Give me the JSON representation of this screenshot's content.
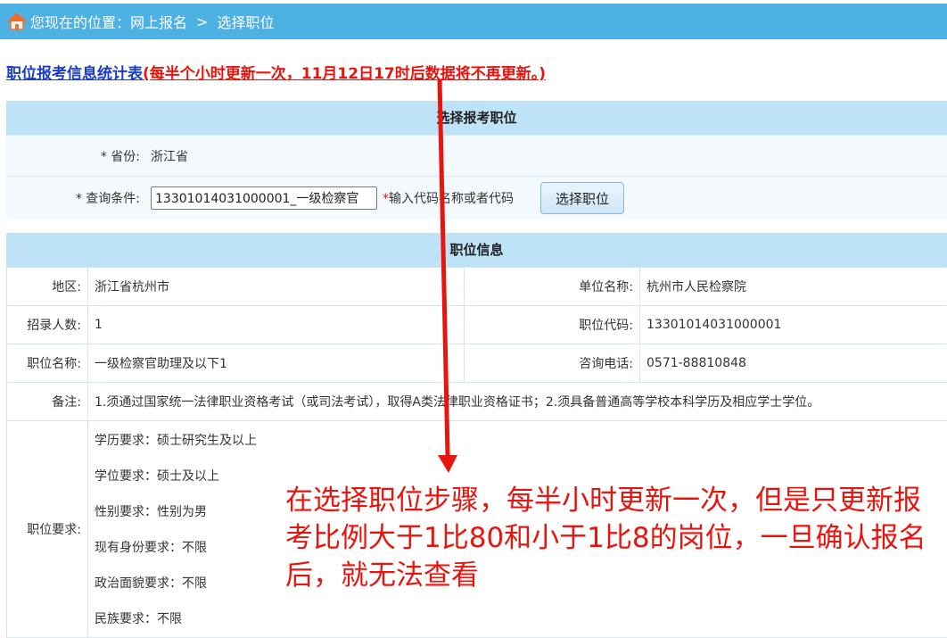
{
  "breadcrumb": {
    "prefix": "您现在的位置：",
    "items": [
      "网上报名",
      "选择职位"
    ],
    "separator": ">"
  },
  "headline": {
    "link": "职位报考信息统计表",
    "note": "(每半个小时更新一次，11月12日17时后数据将不再更新。)"
  },
  "select_panel": {
    "title": "选择报考职位",
    "province_label": "* 省份:",
    "province_value": "浙江省",
    "query_label": "* 查询条件:",
    "query_value": "13301014031000001_一级检察官",
    "hint_mark": "*",
    "hint": "输入代码名称或者代码",
    "button": "选择职位"
  },
  "info_panel": {
    "title": "职位信息",
    "rows": [
      {
        "k1": "地区:",
        "v1": "浙江省杭州市",
        "k2": "单位名称:",
        "v2": "杭州市人民检察院"
      },
      {
        "k1": "招录人数:",
        "v1": "1",
        "k2": "职位代码:",
        "v2": "13301014031000001"
      },
      {
        "k1": "职位名称:",
        "v1": "一级检察官助理及以下1",
        "k2": "咨询电话:",
        "v2": "0571-88810848"
      }
    ],
    "remark_label": "备注:",
    "remark": "1.须通过国家统一法律职业资格考试（或司法考试），取得A类法律职业资格证书；2.须具备普通高等学校本科学历及相应学士学位。",
    "requirements_label": "职位要求:",
    "requirements": [
      "学历要求：硕士研究生及以上",
      "学位要求：硕士及以上",
      "性别要求：性别为男",
      "现有身份要求：不限",
      "政治面貌要求：不限",
      "民族要求：不限"
    ]
  },
  "annotation": "在选择职位步骤，每半小时更新一次，但是只更新报考比例大于1比80和小于1比8的岗位，一旦确认报名后，就无法查看",
  "colors": {
    "topbar": "#4eb1e4",
    "panel_head": "#bfe3f6",
    "link": "#1a3cc9",
    "alert": "#e8140e"
  }
}
